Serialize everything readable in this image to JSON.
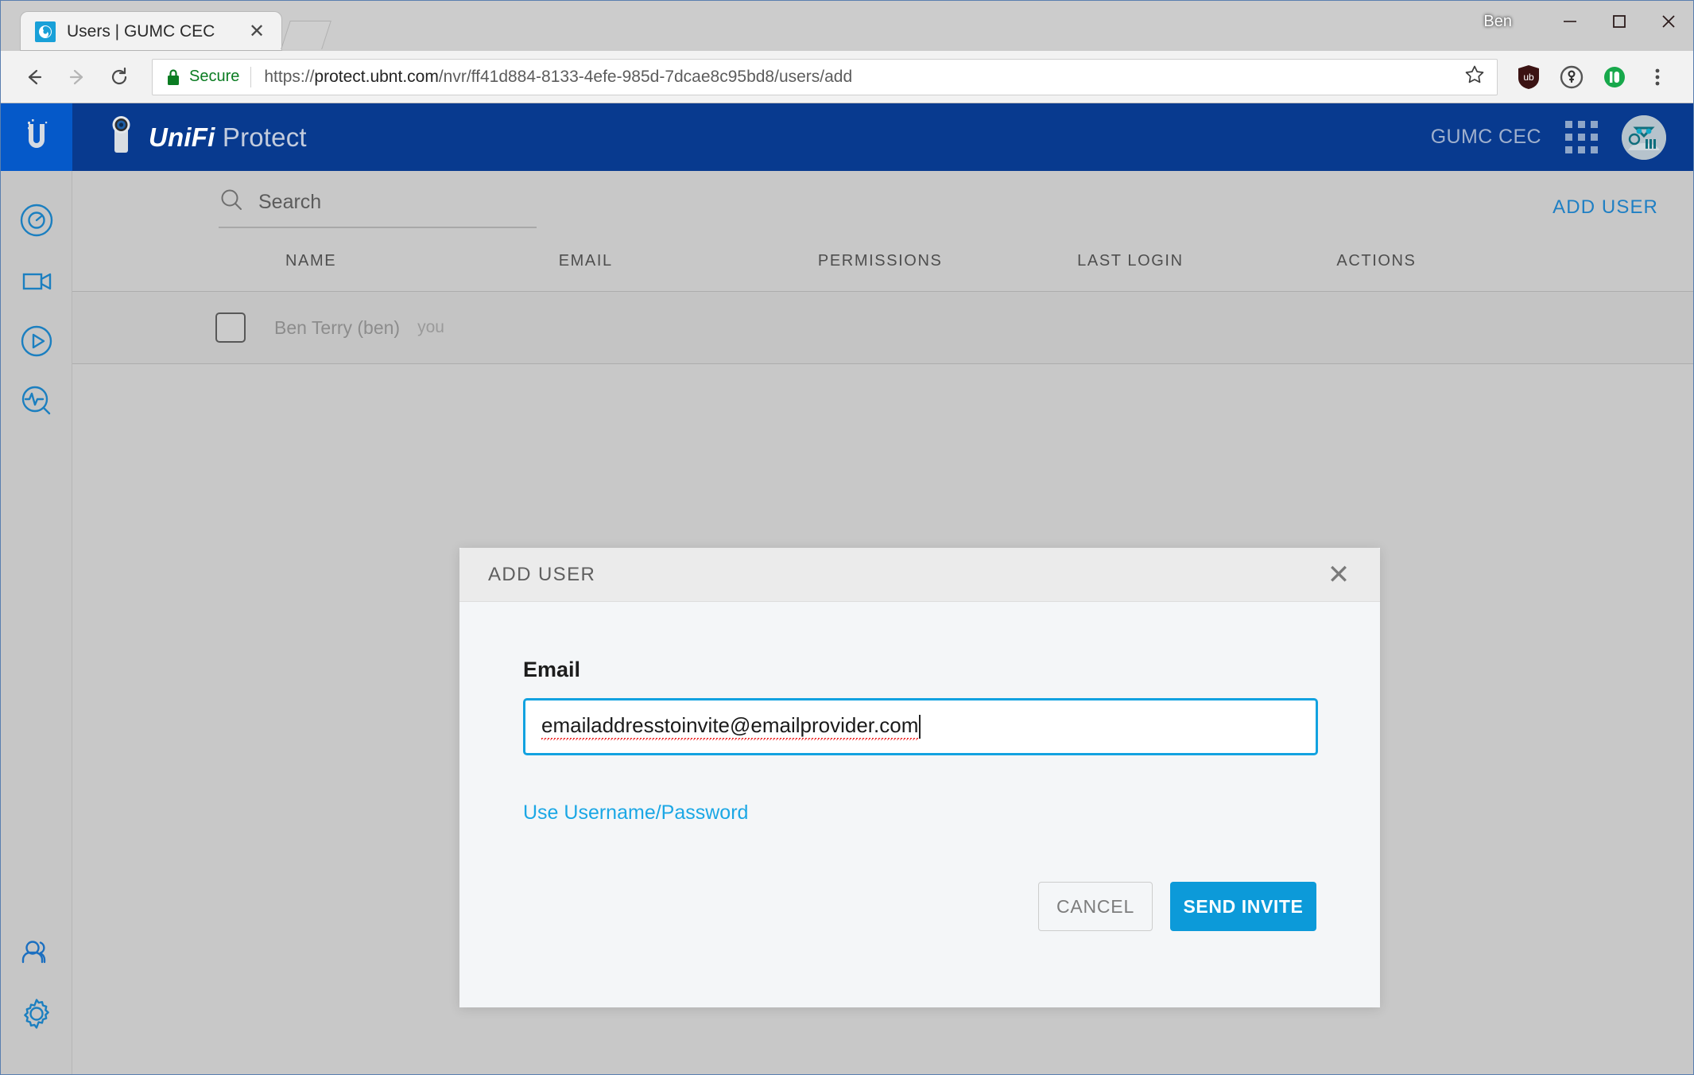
{
  "window": {
    "profile_name": "Ben",
    "minimize_icon": "minimize-icon",
    "maximize_icon": "maximize-icon",
    "close_icon": "close-icon"
  },
  "browser": {
    "tab": {
      "title": "Users | GUMC CEC",
      "favicon": "site-favicon",
      "close_icon": "close-icon"
    },
    "new_tab_label": "",
    "back_icon": "back-arrow-icon",
    "forward_icon": "forward-arrow-icon",
    "reload_icon": "reload-icon",
    "security": {
      "lock_icon": "lock-icon",
      "label": "Secure",
      "color": "#0b7c22"
    },
    "url": {
      "scheme": "https://",
      "host": "protect.ubnt.com",
      "path": "/nvr/ff41d884-8133-4efe-985d-7dcae8c95bd8/users/add",
      "full": "https://protect.ubnt.com/nvr/ff41d884-8133-4efe-985d-7dcae8c95bd8/users/add"
    },
    "bookmark_icon": "star-icon",
    "extensions": [
      {
        "name": "ublock-origin-icon",
        "color": "#3a1414"
      },
      {
        "name": "1password-icon",
        "color": "#555555"
      },
      {
        "name": "pushbullet-icon",
        "color": "#17a84b"
      }
    ],
    "menu_icon": "kebab-menu-icon"
  },
  "app": {
    "brand": {
      "logo_icon": "ubiquiti-u-logo",
      "camera_icon": "unifi-camera-icon",
      "name_strong": "UniFi",
      "name_light": " Protect",
      "logo_tile_color": "#0559c9",
      "bar_color": "#083a8f"
    },
    "site_name": "GUMC CEC",
    "apps_grid_icon": "apps-grid-icon",
    "avatar_icon": "user-avatar",
    "sidebar": {
      "top_items": [
        {
          "icon": "dashboard-icon",
          "label": "Dashboard"
        },
        {
          "icon": "cameras-icon",
          "label": "Cameras"
        },
        {
          "icon": "recordings-play-icon",
          "label": "Recordings"
        },
        {
          "icon": "detections-search-icon",
          "label": "Detections"
        }
      ],
      "bottom_items": [
        {
          "icon": "users-icon",
          "label": "Users"
        },
        {
          "icon": "gear-icon",
          "label": "Settings"
        }
      ],
      "accent_color": "#1b7fc0"
    },
    "toolbar": {
      "search_icon": "search-icon",
      "search_placeholder": "Search",
      "search_value": "",
      "add_user_label": "ADD USER",
      "add_user_color": "#1e7fc4"
    },
    "table": {
      "columns": [
        "NAME",
        "EMAIL",
        "PERMISSIONS",
        "LAST LOGIN",
        "ACTIONS"
      ],
      "rows": [
        {
          "checkbox_checked": false,
          "name": "Ben Terry (ben)",
          "you_badge": "you",
          "email": "",
          "permissions": "",
          "last_login": "",
          "actions": ""
        }
      ]
    }
  },
  "modal": {
    "title": "ADD USER",
    "close_icon": "close-icon",
    "email_label": "Email",
    "email_value": "emailaddresstoinvite@emailprovider.com",
    "email_placeholder": "",
    "email_focus_color": "#12a2e0",
    "alt_link_label": "Use Username/Password",
    "alt_link_color": "#1ba7e5",
    "cancel_label": "CANCEL",
    "send_label": "SEND INVITE",
    "send_color": "#0c9ad9"
  }
}
